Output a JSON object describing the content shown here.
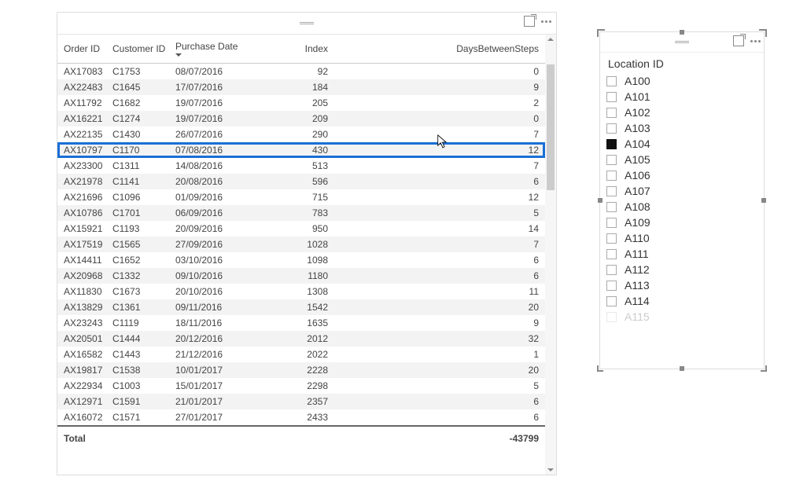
{
  "table": {
    "columns": {
      "order_id": "Order ID",
      "customer_id": "Customer ID",
      "purchase_date": "Purchase Date",
      "index": "Index",
      "days_between": "DaysBetweenSteps"
    },
    "sort_col": "purchase_date",
    "highlight_row": 5,
    "rows": [
      {
        "order_id": "AX17083",
        "customer_id": "C1753",
        "purchase_date": "08/07/2016",
        "index": "92",
        "days": "0"
      },
      {
        "order_id": "AX22483",
        "customer_id": "C1645",
        "purchase_date": "17/07/2016",
        "index": "184",
        "days": "9"
      },
      {
        "order_id": "AX11792",
        "customer_id": "C1682",
        "purchase_date": "19/07/2016",
        "index": "205",
        "days": "2"
      },
      {
        "order_id": "AX16221",
        "customer_id": "C1274",
        "purchase_date": "19/07/2016",
        "index": "209",
        "days": "0"
      },
      {
        "order_id": "AX22135",
        "customer_id": "C1430",
        "purchase_date": "26/07/2016",
        "index": "290",
        "days": "7"
      },
      {
        "order_id": "AX10797",
        "customer_id": "C1170",
        "purchase_date": "07/08/2016",
        "index": "430",
        "days": "12"
      },
      {
        "order_id": "AX23300",
        "customer_id": "C1311",
        "purchase_date": "14/08/2016",
        "index": "513",
        "days": "7"
      },
      {
        "order_id": "AX21978",
        "customer_id": "C1141",
        "purchase_date": "20/08/2016",
        "index": "596",
        "days": "6"
      },
      {
        "order_id": "AX21696",
        "customer_id": "C1096",
        "purchase_date": "01/09/2016",
        "index": "715",
        "days": "12"
      },
      {
        "order_id": "AX10786",
        "customer_id": "C1701",
        "purchase_date": "06/09/2016",
        "index": "783",
        "days": "5"
      },
      {
        "order_id": "AX15921",
        "customer_id": "C1193",
        "purchase_date": "20/09/2016",
        "index": "950",
        "days": "14"
      },
      {
        "order_id": "AX17519",
        "customer_id": "C1565",
        "purchase_date": "27/09/2016",
        "index": "1028",
        "days": "7"
      },
      {
        "order_id": "AX14411",
        "customer_id": "C1652",
        "purchase_date": "03/10/2016",
        "index": "1098",
        "days": "6"
      },
      {
        "order_id": "AX20968",
        "customer_id": "C1332",
        "purchase_date": "09/10/2016",
        "index": "1180",
        "days": "6"
      },
      {
        "order_id": "AX11830",
        "customer_id": "C1673",
        "purchase_date": "20/10/2016",
        "index": "1308",
        "days": "11"
      },
      {
        "order_id": "AX13829",
        "customer_id": "C1361",
        "purchase_date": "09/11/2016",
        "index": "1542",
        "days": "20"
      },
      {
        "order_id": "AX23243",
        "customer_id": "C1119",
        "purchase_date": "18/11/2016",
        "index": "1635",
        "days": "9"
      },
      {
        "order_id": "AX20501",
        "customer_id": "C1444",
        "purchase_date": "20/12/2016",
        "index": "2012",
        "days": "32"
      },
      {
        "order_id": "AX16582",
        "customer_id": "C1443",
        "purchase_date": "21/12/2016",
        "index": "2022",
        "days": "1"
      },
      {
        "order_id": "AX19817",
        "customer_id": "C1538",
        "purchase_date": "10/01/2017",
        "index": "2228",
        "days": "20"
      },
      {
        "order_id": "AX22934",
        "customer_id": "C1003",
        "purchase_date": "15/01/2017",
        "index": "2298",
        "days": "5"
      },
      {
        "order_id": "AX12971",
        "customer_id": "C1591",
        "purchase_date": "21/01/2017",
        "index": "2357",
        "days": "6"
      },
      {
        "order_id": "AX16072",
        "customer_id": "C1571",
        "purchase_date": "27/01/2017",
        "index": "2433",
        "days": "6"
      }
    ],
    "total_label": "Total",
    "total_value": "-43799"
  },
  "slicer": {
    "title": "Location ID",
    "items": [
      {
        "label": "A100",
        "selected": false
      },
      {
        "label": "A101",
        "selected": false
      },
      {
        "label": "A102",
        "selected": false
      },
      {
        "label": "A103",
        "selected": false
      },
      {
        "label": "A104",
        "selected": true
      },
      {
        "label": "A105",
        "selected": false
      },
      {
        "label": "A106",
        "selected": false
      },
      {
        "label": "A107",
        "selected": false
      },
      {
        "label": "A108",
        "selected": false
      },
      {
        "label": "A109",
        "selected": false
      },
      {
        "label": "A110",
        "selected": false
      },
      {
        "label": "A111",
        "selected": false
      },
      {
        "label": "A112",
        "selected": false
      },
      {
        "label": "A113",
        "selected": false
      },
      {
        "label": "A114",
        "selected": false
      },
      {
        "label": "A115",
        "selected": false
      }
    ]
  }
}
